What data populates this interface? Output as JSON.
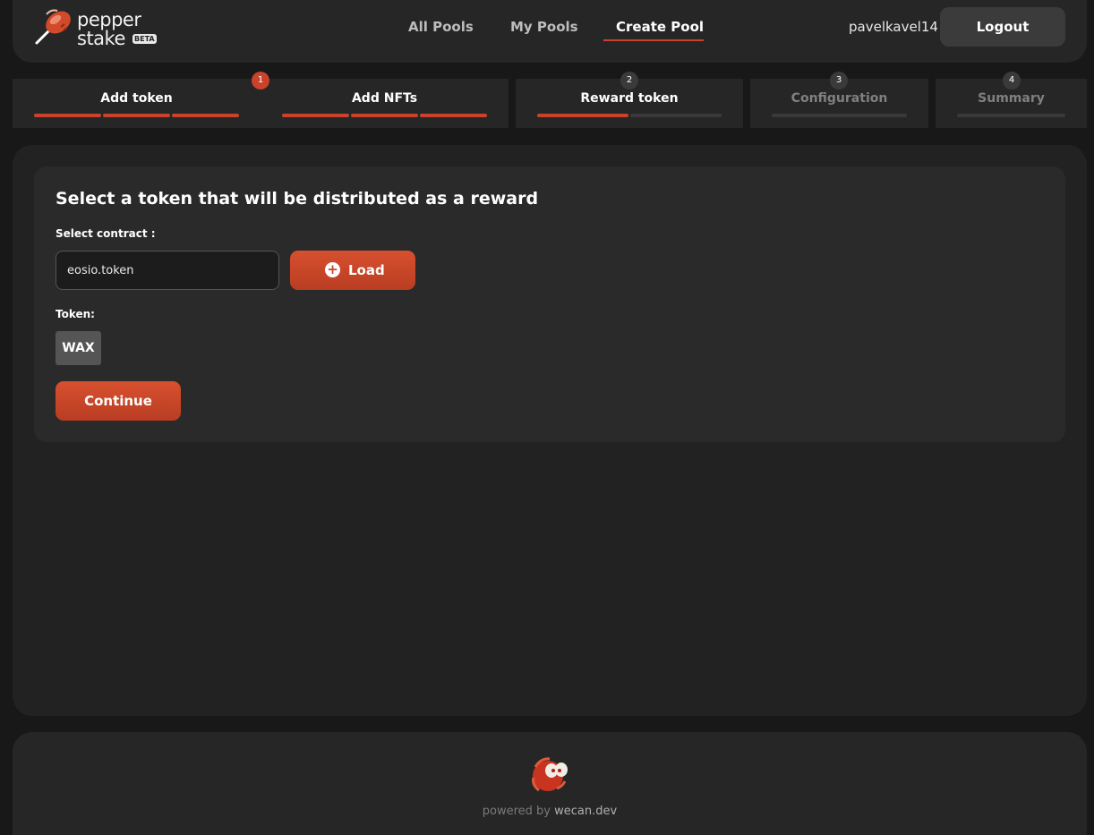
{
  "brand": {
    "line1": "pepper",
    "line2": "stake",
    "badge": "BETA"
  },
  "nav": {
    "items": [
      "All Pools",
      "My Pools",
      "Create Pool"
    ],
    "active": "Create Pool"
  },
  "user": {
    "name": "pavelkavel14",
    "logout_label": "Logout"
  },
  "steps": [
    {
      "label": "Add token",
      "badge": "1",
      "progress": 1.0
    },
    {
      "label": "Add NFTs",
      "badge": "",
      "progress": 1.0
    },
    {
      "label": "Reward token",
      "badge": "2",
      "progress": 0.5
    },
    {
      "label": "Configuration",
      "badge": "3",
      "progress": 0
    },
    {
      "label": "Summary",
      "badge": "4",
      "progress": 0
    }
  ],
  "form": {
    "title": "Select a token that will be distributed as a reward",
    "contract_label": "Select contract :",
    "contract_value": "eosio.token",
    "load_label": "Load",
    "token_label": "Token:",
    "token_option": "WAX",
    "continue_label": "Continue"
  },
  "footer": {
    "powered_prefix": "powered by",
    "powered_brand": "wecan.dev"
  },
  "colors": {
    "accent": "#c9432a",
    "background": "#181818",
    "panel": "#222222"
  },
  "icons": [
    "pepper-logo-icon",
    "plus-circle-icon",
    "wecan-mascot-icon"
  ]
}
